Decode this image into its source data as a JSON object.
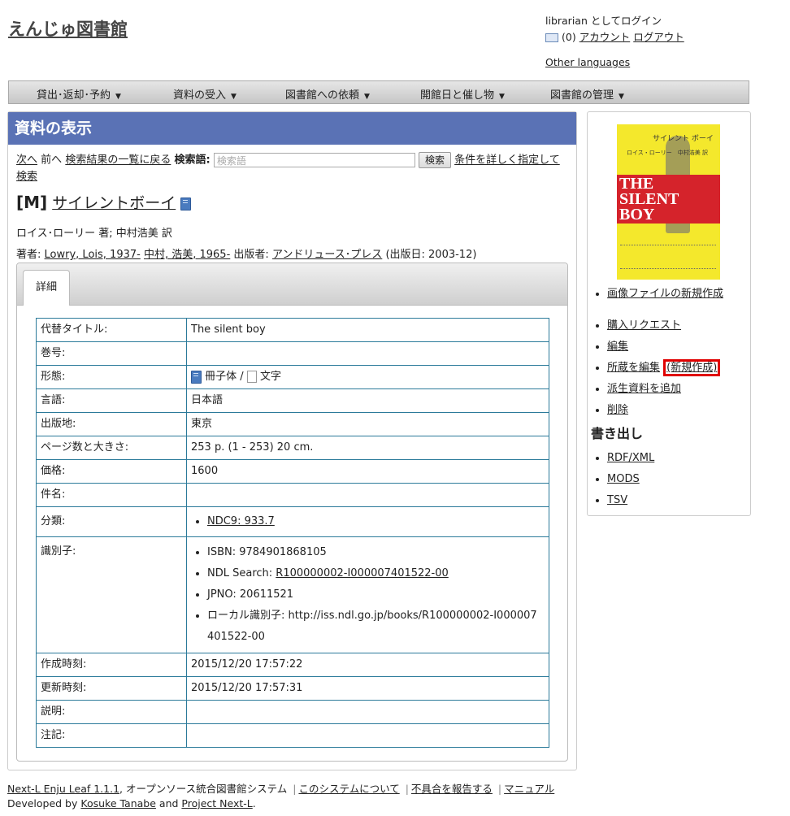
{
  "site": {
    "title": "えんじゅ図書館"
  },
  "login": {
    "user_text": "librarian としてログイン",
    "message_count": "(0)",
    "account": "アカウント",
    "logout": "ログアウト",
    "other_languages": "Other languages"
  },
  "menu": [
    {
      "label": "貸出･返却･予約"
    },
    {
      "label": "資料の受入"
    },
    {
      "label": "図書館への依頼"
    },
    {
      "label": "開館日と催し物"
    },
    {
      "label": "図書館の管理"
    }
  ],
  "page": {
    "heading": "資料の表示"
  },
  "nav": {
    "next": "次へ",
    "prev": "前へ",
    "back_to_results": "検索結果の一覧に戻る",
    "search_label": "検索語:",
    "search_placeholder": "検索語",
    "search_button": "検索",
    "advanced_search": "条件を詳しく指定して検索"
  },
  "record": {
    "type_tag": "[M]",
    "title": "サイレントボーイ",
    "statement": "ロイス･ローリー 著; 中村浩美 訳",
    "creators_label": "著者:",
    "creators": [
      "Lowry, Lois, 1937-",
      "中村, 浩美, 1965-"
    ],
    "publisher_label": "出版者:",
    "publisher": "アンドリュース･プレス",
    "pub_date": "(出版日: 2003-12)"
  },
  "tabs": [
    {
      "label": "詳細"
    }
  ],
  "details": {
    "alt_title": {
      "label": "代替タイトル:",
      "value": "The silent boy"
    },
    "volume": {
      "label": "巻号:",
      "value": ""
    },
    "form": {
      "label": "形態:",
      "carrier": "冊子体",
      "sep": "/",
      "content": "文字"
    },
    "language": {
      "label": "言語:",
      "value": "日本語"
    },
    "place": {
      "label": "出版地:",
      "value": "東京"
    },
    "extent": {
      "label": "ページ数と大きさ:",
      "value": "253 p. (1 - 253) 20 cm."
    },
    "price": {
      "label": "価格:",
      "value": "1600"
    },
    "subject": {
      "label": "件名:",
      "value": ""
    },
    "classification": {
      "label": "分類:",
      "value": "NDC9: 933.7"
    },
    "identifiers": {
      "label": "識別子:",
      "isbn": "ISBN: 9784901868105",
      "ndl_label": "NDL Search: ",
      "ndl_value": "R100000002-I000007401522-00",
      "jpno": "JPNO: 20611521",
      "local_line1": "ローカル識別子: http://iss.ndl.go.jp/books/R100000002-I000007",
      "local_line2": "401522-00"
    },
    "created": {
      "label": "作成時刻:",
      "value": "2015/12/20 17:57:22"
    },
    "updated": {
      "label": "更新時刻:",
      "value": "2015/12/20 17:57:31"
    },
    "description": {
      "label": "説明:",
      "value": ""
    },
    "note": {
      "label": "注記:",
      "value": ""
    }
  },
  "cover": {
    "jp_title": "サイレント ボーイ",
    "jp_authors": "ロイス・ローリー　中村浩美 訳",
    "line1": "THE",
    "line2": "SILENT",
    "line3": "BOY"
  },
  "sidebar": {
    "new_picture": "画像ファイルの新規作成",
    "purchase_request": "購入リクエスト",
    "edit": "編集",
    "edit_items": "所蔵を編集",
    "new_item": "(新規作成)",
    "add_derivative": "派生資料を追加",
    "delete": "削除",
    "export_heading": "書き出し",
    "exports": [
      "RDF/XML",
      "MODS",
      "TSV"
    ]
  },
  "footer": {
    "product": "Next-L Enju Leaf 1.1.1",
    "product_desc": ", オープンソース統合図書館システム",
    "about": "このシステムについて",
    "report": "不具合を報告する",
    "manual": "マニュアル",
    "developed_by": "Developed by ",
    "dev1": "Kosuke Tanabe",
    "and": " and ",
    "dev2": "Project Next-L",
    "period": "."
  }
}
